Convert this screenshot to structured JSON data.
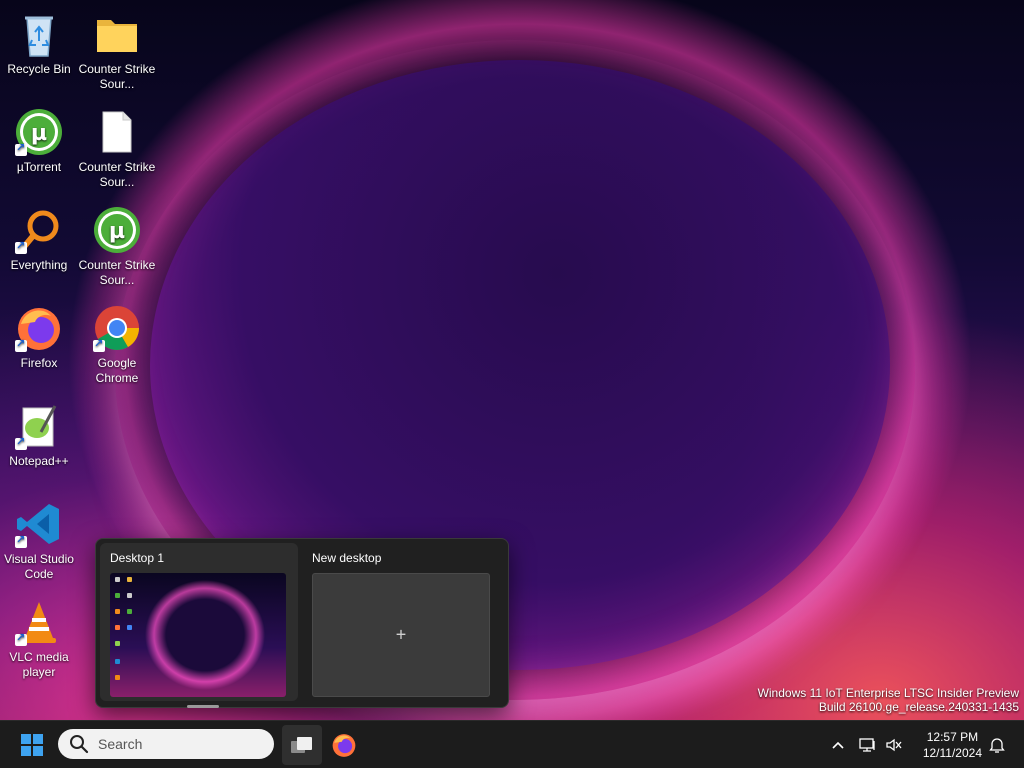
{
  "desktop_icons": [
    {
      "label": "Recycle Bin",
      "icon": "recycle-bin-icon"
    },
    {
      "label": "Counter Strike Sour...",
      "icon": "folder-icon"
    },
    {
      "label": "µTorrent",
      "icon": "utorrent-icon"
    },
    {
      "label": "Counter Strike Sour...",
      "icon": "blank-file-icon"
    },
    {
      "label": "Everything",
      "icon": "everything-search-icon"
    },
    {
      "label": "Counter Strike Sour...",
      "icon": "utorrent-icon"
    },
    {
      "label": "Firefox",
      "icon": "firefox-icon"
    },
    {
      "label": "Google Chrome",
      "icon": "chrome-icon"
    },
    {
      "label": "Notepad++",
      "icon": "notepadplusplus-icon"
    },
    {
      "label": "Visual Studio Code",
      "icon": "vscode-icon"
    },
    {
      "label": "VLC media player",
      "icon": "vlc-icon"
    }
  ],
  "task_view": {
    "desktops": [
      {
        "title": "Desktop 1",
        "active": true
      },
      {
        "title": "New desktop",
        "add_symbol": "+"
      }
    ]
  },
  "watermark": {
    "line1": "Windows 11 IoT Enterprise LTSC Insider Preview",
    "line2": "Build 26100.ge_release.240331-1435"
  },
  "taskbar": {
    "search_placeholder": "Search",
    "clock_time": "12:57 PM",
    "clock_date": "12/11/2024",
    "pinned": [
      "task-view",
      "firefox"
    ]
  },
  "colors": {
    "taskbar_bg": "#1c1c1c",
    "flyout_bg": "#202020",
    "accent_blue": "#3ea3f0"
  }
}
